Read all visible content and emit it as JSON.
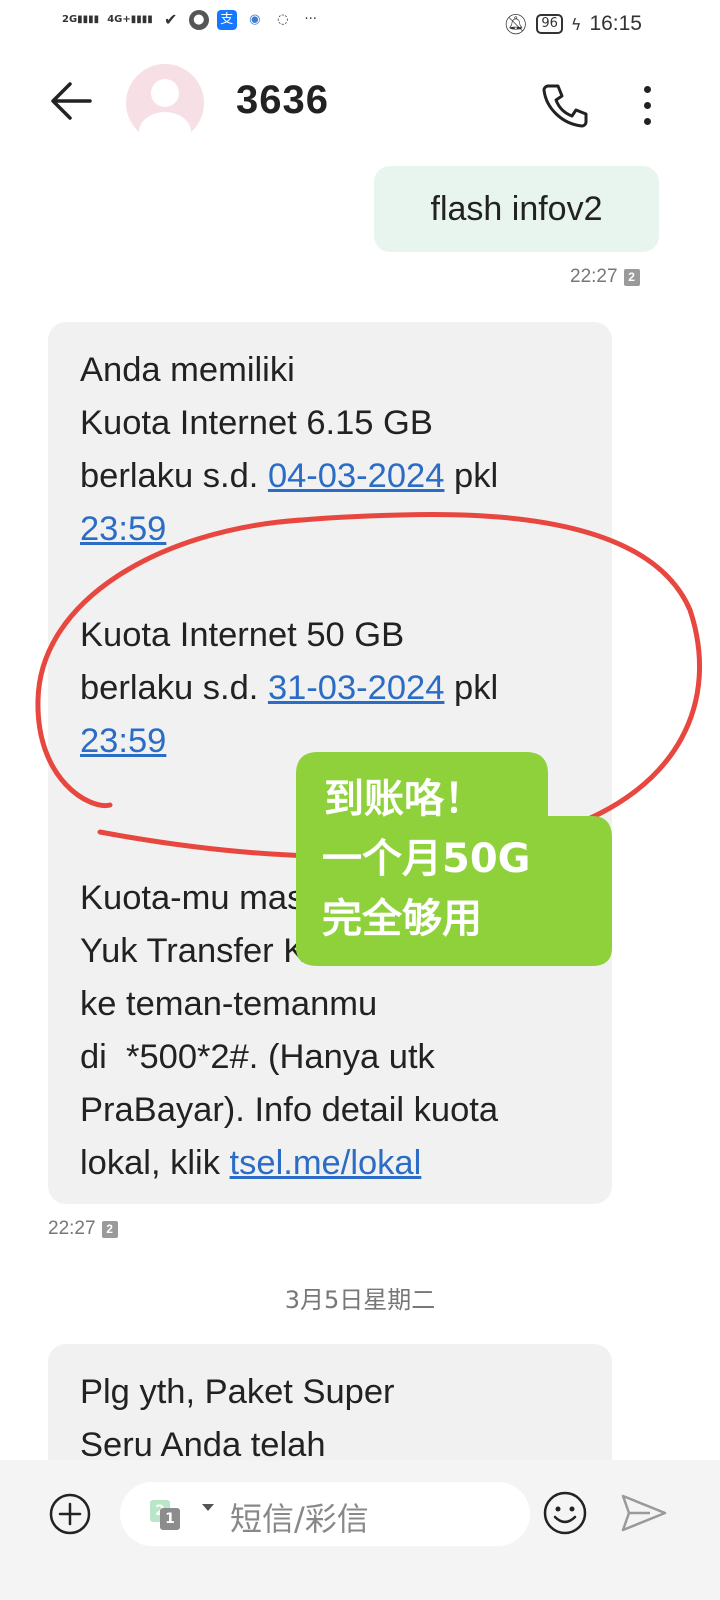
{
  "status_bar": {
    "signal_1": "2G",
    "signal_2": "4G+",
    "battery": "96",
    "time": "16:15",
    "icons": [
      "signal-icon",
      "wechat-icon",
      "alipay-icon",
      "browser-icon",
      "chat-icon",
      "more-notifications-icon",
      "mute-icon",
      "battery-icon",
      "charging-icon"
    ]
  },
  "header": {
    "contact_name": "3636"
  },
  "messages": {
    "outgoing_1": {
      "text": "flash infov2",
      "time": "22:27",
      "sim": "2"
    },
    "incoming_1": {
      "line_1": "Anda memiliki",
      "line_2": "Kuota Internet 6.15 GB",
      "line_3_prefix": "berlaku s.d. ",
      "line_3_date": "04-03-2024",
      "line_3_suffix": " pkl",
      "line_4_time": "23:59",
      "line_5": "Kuota Internet 50 GB",
      "line_6_prefix": "berlaku s.d. ",
      "line_6_date": "31-03-2024",
      "line_6_suffix": " pkl",
      "line_7_time": "23:59",
      "line_8": "Kuota-mu masih banyak?",
      "line_9": "Yuk Transfer Kuota",
      "line_10": "ke teman-temanmu",
      "line_11": "di  *500*2#. (Hanya utk",
      "line_12": "PraBayar). Info detail kuota",
      "line_13_prefix": "lokal, klik ",
      "line_13_link": "tsel.me/lokal",
      "time": "22:27",
      "sim": "2"
    },
    "date_separator": "3月5日星期二",
    "incoming_2": {
      "line_1": "Plg yth, Paket Super",
      "line_2": "Seru Anda telah"
    }
  },
  "annotation": {
    "sticker_line_1": "到账咯！",
    "sticker_line_2": "一个月50G",
    "sticker_line_3": "完全够用",
    "sticker_color": "#8fd13a",
    "circle_color": "#e8473f"
  },
  "input_bar": {
    "sim_1": "2",
    "sim_2": "1",
    "placeholder": "短信/彩信"
  },
  "colors": {
    "outgoing_bubble": "#e8f5ee",
    "incoming_bubble": "#f1f1f1",
    "link": "#2a6cc6"
  }
}
